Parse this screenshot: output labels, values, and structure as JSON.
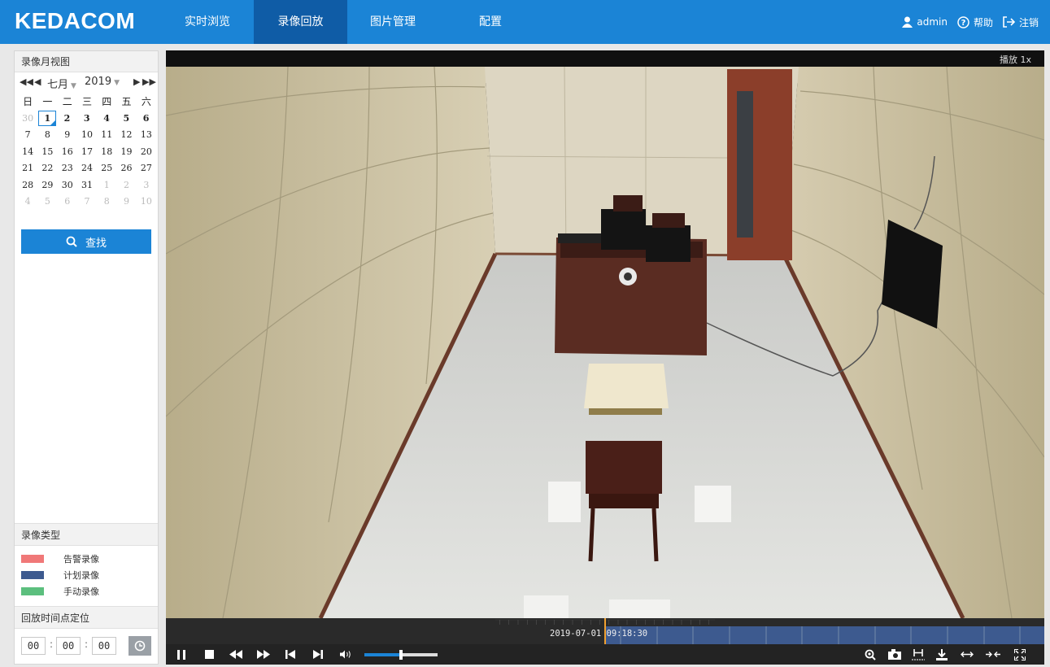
{
  "brand": {
    "logo": "KEDACOM",
    "accent": "#1b84d6",
    "accent_dark": "#0f5ca6"
  },
  "nav": [
    {
      "label": "实时浏览",
      "active": false
    },
    {
      "label": "录像回放",
      "active": true
    },
    {
      "label": "图片管理",
      "active": false
    },
    {
      "label": "配置",
      "active": false
    }
  ],
  "user": {
    "name": "admin",
    "help": "帮助",
    "logout": "注销"
  },
  "calendar": {
    "title": "录像月视图",
    "month": "七月",
    "year": "2019",
    "weekdays": [
      "日",
      "一",
      "二",
      "三",
      "四",
      "五",
      "六"
    ],
    "weeks": [
      [
        "30",
        "1",
        "2",
        "3",
        "4",
        "5",
        "6"
      ],
      [
        "7",
        "8",
        "9",
        "10",
        "11",
        "12",
        "13"
      ],
      [
        "14",
        "15",
        "16",
        "17",
        "18",
        "19",
        "20"
      ],
      [
        "21",
        "22",
        "23",
        "24",
        "25",
        "26",
        "27"
      ],
      [
        "28",
        "29",
        "30",
        "31",
        "1",
        "2",
        "3"
      ],
      [
        "4",
        "5",
        "6",
        "7",
        "8",
        "9",
        "10"
      ]
    ],
    "selected_day": "1"
  },
  "search": {
    "label": "查找",
    "icon": "search-icon"
  },
  "record_type": {
    "title": "录像类型",
    "items": [
      {
        "label": "告警录像",
        "color": "#f07878"
      },
      {
        "label": "计划录像",
        "color": "#3d5a8f"
      },
      {
        "label": "手动录像",
        "color": "#5cbf7e"
      }
    ]
  },
  "locate": {
    "title": "回放时间点定位",
    "hour": "00",
    "minute": "00",
    "second": "00"
  },
  "player": {
    "status": "播放  1x",
    "timestamp": "2019-07-01 09:18:30",
    "volume": 0.5
  }
}
